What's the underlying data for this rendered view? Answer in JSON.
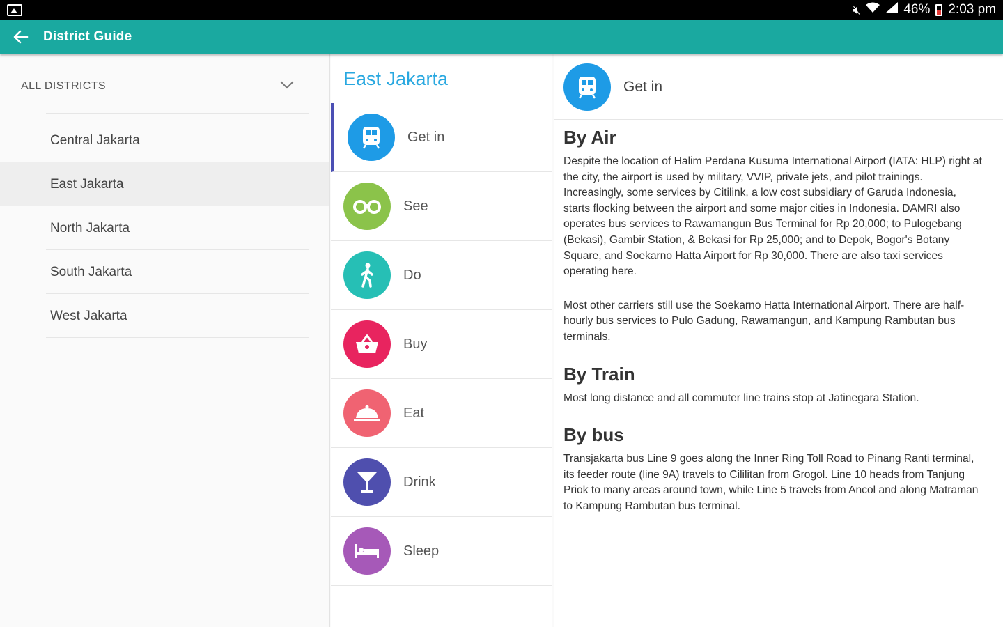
{
  "status_bar": {
    "battery": "46%",
    "time": "2:03 pm"
  },
  "appbar": {
    "title": "District Guide"
  },
  "districts": {
    "header": "ALL DISTRICTS",
    "items": [
      {
        "label": "Central Jakarta",
        "active": false
      },
      {
        "label": "East Jakarta",
        "active": true
      },
      {
        "label": "North Jakarta",
        "active": false
      },
      {
        "label": "South Jakarta",
        "active": false
      },
      {
        "label": "West Jakarta",
        "active": false
      }
    ]
  },
  "district_title": "East Jakarta",
  "categories": [
    {
      "label": "Get in",
      "icon": "train-icon",
      "color": "#1e9be6",
      "active": true
    },
    {
      "label": "See",
      "icon": "binoculars-icon",
      "color": "#8bc34a",
      "active": false
    },
    {
      "label": "Do",
      "icon": "walking-person-icon",
      "color": "#26bfb5",
      "active": false
    },
    {
      "label": "Buy",
      "icon": "shopping-basket-icon",
      "color": "#e8245f",
      "active": false
    },
    {
      "label": "Eat",
      "icon": "food-cloche-icon",
      "color": "#f06372",
      "active": false
    },
    {
      "label": "Drink",
      "icon": "cocktail-icon",
      "color": "#4f4fae",
      "active": false
    },
    {
      "label": "Sleep",
      "icon": "bed-icon",
      "color": "#a659b8",
      "active": false
    }
  ],
  "detail": {
    "title": "Get in",
    "color": "#1e9be6",
    "sections": [
      {
        "title": "By Air",
        "paragraphs": [
          "Despite the location of Halim Perdana Kusuma International Airport (IATA: HLP) right at the city, the airport is used by military, VVIP, private jets, and pilot trainings. Increasingly, some services by Citilink, a low cost subsidiary of Garuda Indonesia, starts flocking between the airport and some major cities in Indonesia. DAMRI also operates bus services to Rawamangun Bus Terminal for Rp 20,000; to Pulogebang (Bekasi), Gambir Station, & Bekasi for Rp 25,000; and to Depok, Bogor's Botany Square, and Soekarno Hatta Airport for Rp 30,000. There are also taxi services operating here.",
          "Most other carriers still use the Soekarno Hatta International Airport. There are half-hourly bus services to Pulo Gadung, Rawamangun, and Kampung Rambutan bus terminals."
        ]
      },
      {
        "title": "By Train",
        "paragraphs": [
          "Most long distance and all commuter line trains stop at Jatinegara Station."
        ]
      },
      {
        "title": "By bus",
        "paragraphs": [
          "Transjakarta bus Line 9 goes along the Inner Ring Toll Road to Pinang Ranti terminal, its feeder route (line 9A) travels to Cililitan from Grogol. Line 10 heads from Tanjung Priok to many areas around town, while Line 5 travels from Ancol and along Matraman to Kampung Rambutan bus terminal."
        ]
      }
    ]
  }
}
